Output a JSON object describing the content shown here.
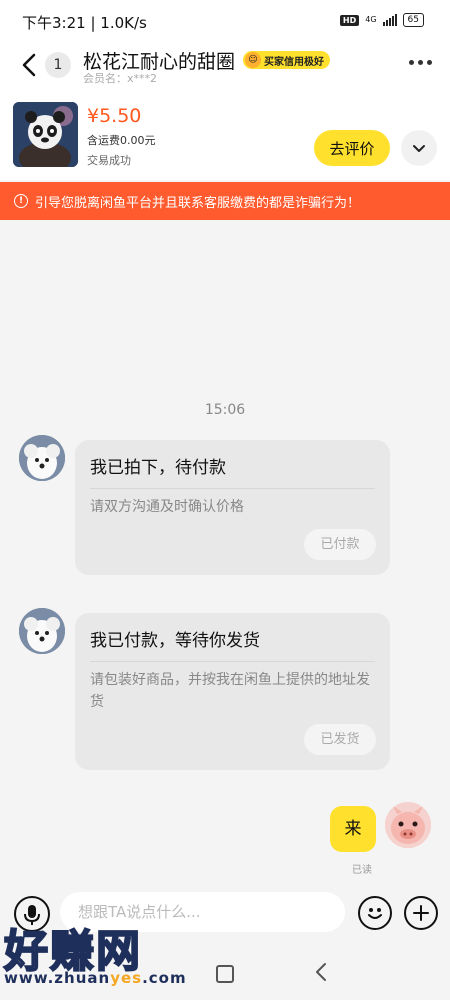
{
  "status_bar": {
    "time": "下午3:21 | 1.0K/s",
    "hd": "HD",
    "network": "4G",
    "battery": "65"
  },
  "header": {
    "back_count": "1",
    "seller_name": "松花江耐心的甜圈",
    "credit_tag": "买家信用极好",
    "member_label": "会员名：x***2"
  },
  "product": {
    "price": "¥5.50",
    "shipping": "含运费0.00元",
    "status": "交易成功",
    "review_button": "去评价"
  },
  "warning": {
    "text": "引导您脱离闲鱼平台并且联系客服缴费的都是诈骗行为！"
  },
  "chat": {
    "time": "15:06",
    "cards": [
      {
        "title": "我已拍下，待付款",
        "desc": "请双方沟通及时确认价格",
        "tag": "已付款"
      },
      {
        "title": "我已付款，等待你发货",
        "desc": "请包装好商品，并按我在闲鱼上提供的地址发货",
        "tag": "已发货"
      }
    ],
    "my_message": "来",
    "read_label": "已读"
  },
  "input": {
    "placeholder": "想跟TA说点什么..."
  },
  "watermark": {
    "big_text": "好赚网",
    "url_prefix": "www.zhuan",
    "url_highlight": "yes",
    "url_suffix": ".com"
  },
  "colors": {
    "accent_yellow": "#ffe02c",
    "price_orange": "#ff5a1f",
    "warning_bg": "#ff5b2e"
  },
  "icons": [
    "back-icon",
    "more-icon",
    "chevron-down-icon",
    "warning-icon",
    "voice-icon",
    "emoji-icon",
    "plus-icon",
    "nav-home-icon",
    "nav-back-icon"
  ]
}
